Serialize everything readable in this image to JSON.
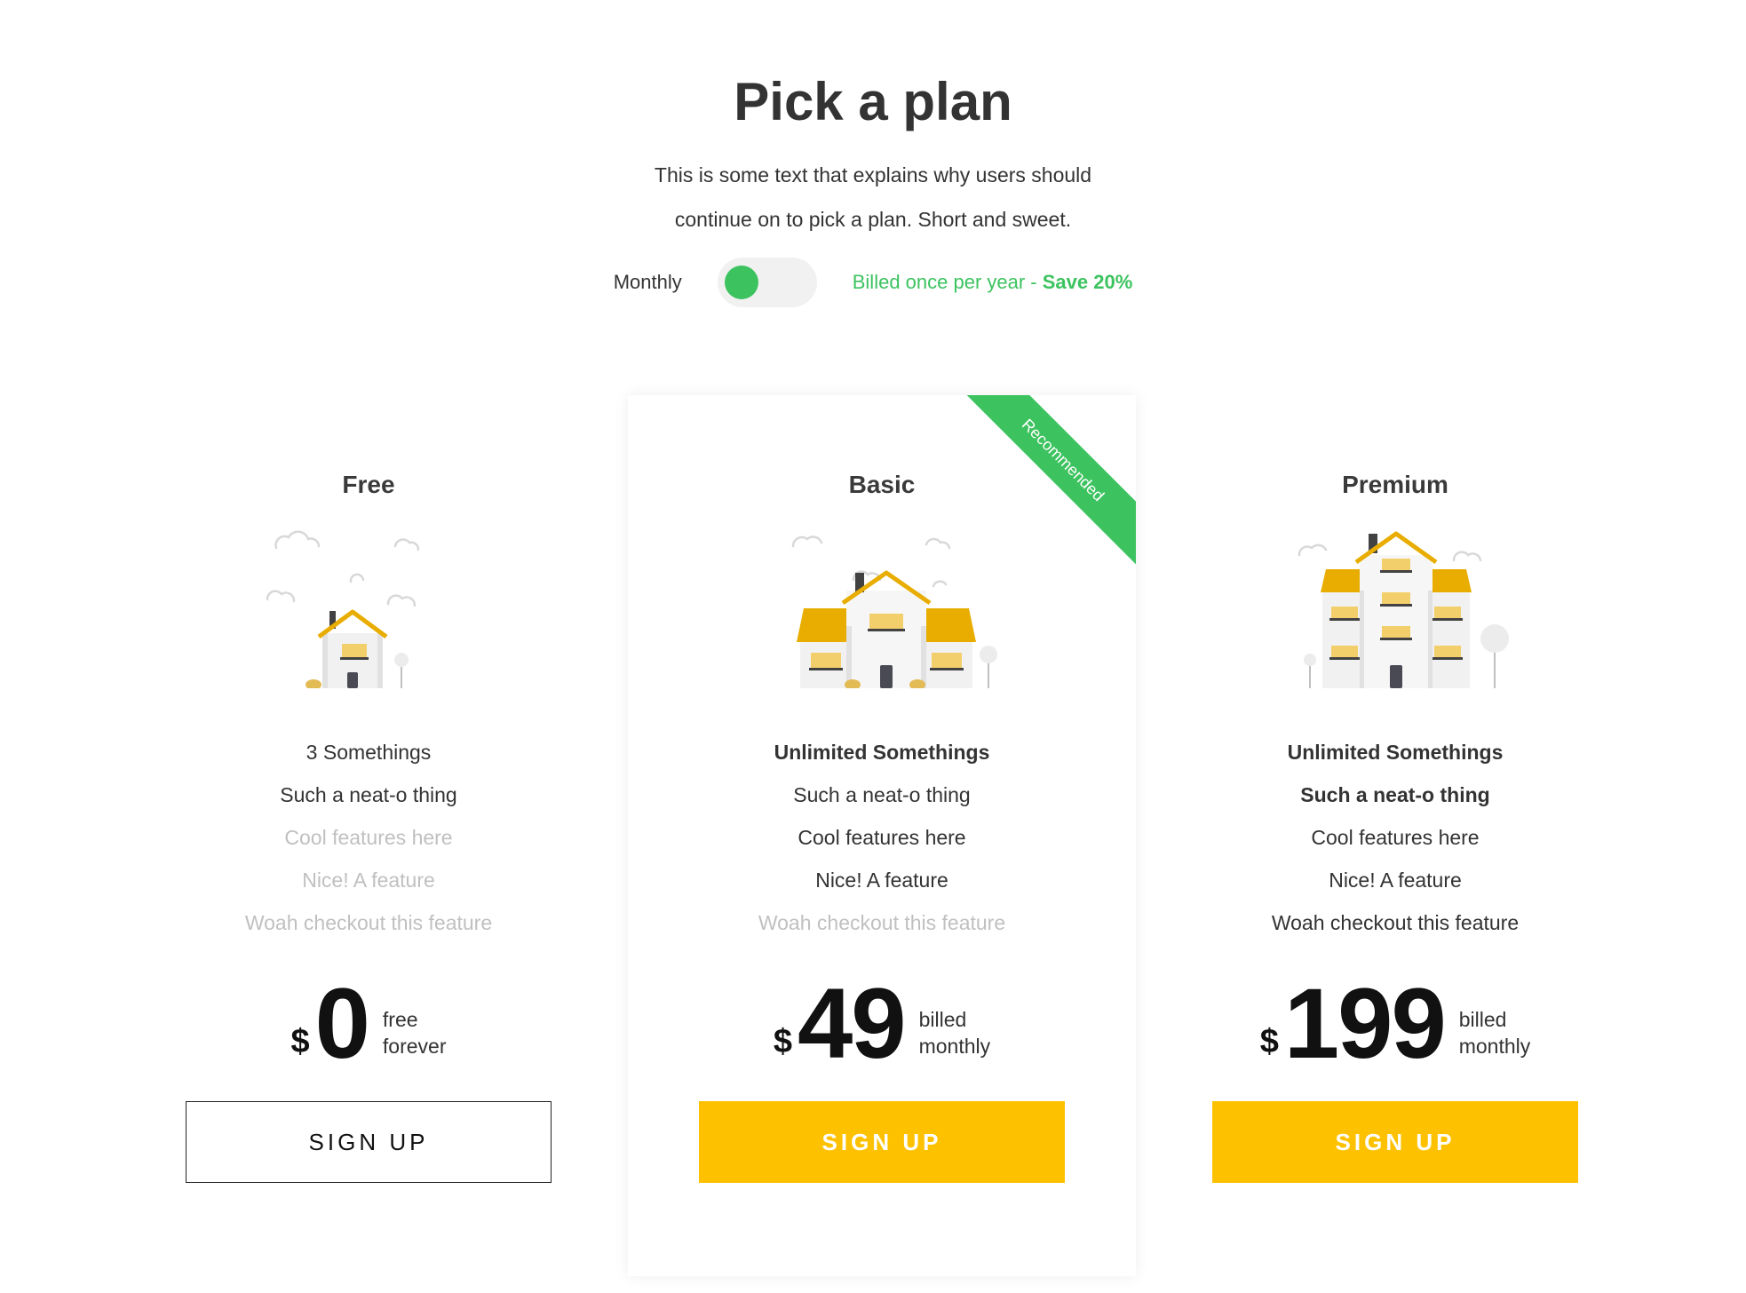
{
  "colors": {
    "accent_green": "#3cc35f",
    "accent_yellow": "#fec100",
    "house_gold": "#e8ad00",
    "window_yellow": "#f3cf6b"
  },
  "header": {
    "title": "Pick a plan",
    "intro_line1": "This is some text that explains why users should",
    "intro_line2": "continue on to pick a plan. Short and sweet."
  },
  "billing": {
    "monthly_label": "Monthly",
    "yearly_label": "Billed once per year - ",
    "yearly_save": "Save 20%",
    "selected": "monthly"
  },
  "plans": [
    {
      "name": "Free",
      "illustration": "small-house-icon",
      "features": [
        {
          "text": "3 Somethings",
          "style": "normal"
        },
        {
          "text": "Such a neat-o thing",
          "style": "normal"
        },
        {
          "text": "Cool features here",
          "style": "muted"
        },
        {
          "text": "Nice! A feature",
          "style": "muted"
        },
        {
          "text": "Woah checkout this feature",
          "style": "muted"
        }
      ],
      "currency": "$",
      "price": "0",
      "price_note_1": "free",
      "price_note_2": "forever",
      "cta": "SIGN UP"
    },
    {
      "name": "Basic",
      "ribbon": "Recommended",
      "illustration": "medium-house-icon",
      "features": [
        {
          "text": "Unlimited Somethings",
          "style": "strong"
        },
        {
          "text": "Such a neat-o thing",
          "style": "normal"
        },
        {
          "text": "Cool features here",
          "style": "normal"
        },
        {
          "text": "Nice! A feature",
          "style": "normal"
        },
        {
          "text": "Woah checkout this feature",
          "style": "muted"
        }
      ],
      "currency": "$",
      "price": "49",
      "price_note_1": "billed",
      "price_note_2": "monthly",
      "cta": "SIGN UP"
    },
    {
      "name": "Premium",
      "illustration": "large-house-icon",
      "features": [
        {
          "text": "Unlimited Somethings",
          "style": "strong"
        },
        {
          "text": "Such a neat-o thing",
          "style": "strong"
        },
        {
          "text": "Cool features here",
          "style": "normal"
        },
        {
          "text": "Nice! A feature",
          "style": "normal"
        },
        {
          "text": "Woah checkout this feature",
          "style": "normal"
        }
      ],
      "currency": "$",
      "price": "199",
      "price_note_1": "billed",
      "price_note_2": "monthly",
      "cta": "SIGN UP"
    }
  ]
}
